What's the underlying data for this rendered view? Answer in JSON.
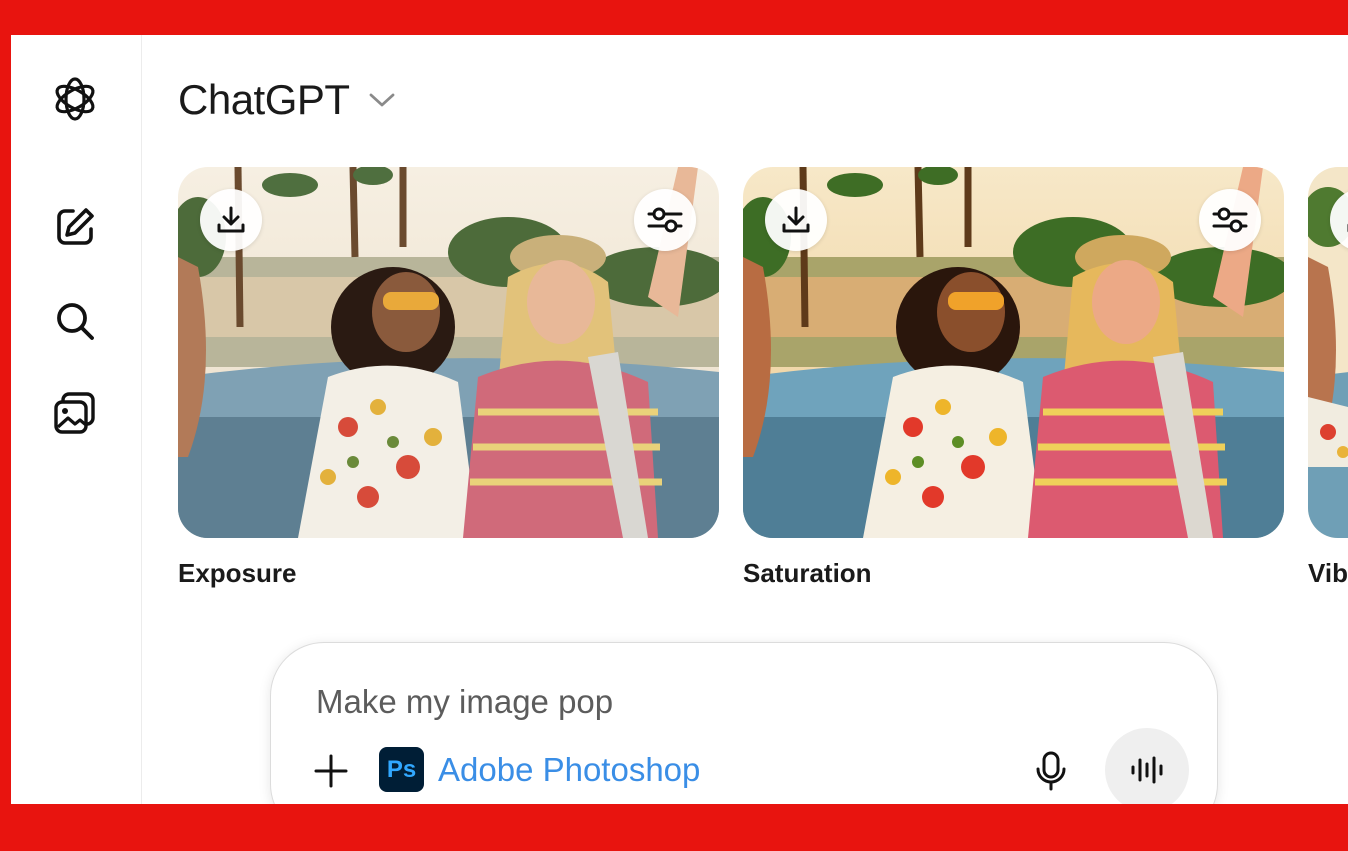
{
  "header": {
    "title": "ChatGPT"
  },
  "sidebar": {
    "items": [
      {
        "icon": "openai-logo-icon"
      },
      {
        "icon": "new-chat-icon"
      },
      {
        "icon": "search-icon"
      },
      {
        "icon": "library-icon"
      }
    ]
  },
  "cards": [
    {
      "label": "Exposure"
    },
    {
      "label": "Saturation"
    },
    {
      "label": "Vib"
    }
  ],
  "composer": {
    "placeholder": "Make my image pop",
    "app_badge": "Ps",
    "app_name": "Adobe Photoshop"
  },
  "colors": {
    "frame": "#e8140f",
    "ps_background": "#001e36",
    "ps_text": "#31a8ff",
    "link": "#3a8ee6"
  }
}
